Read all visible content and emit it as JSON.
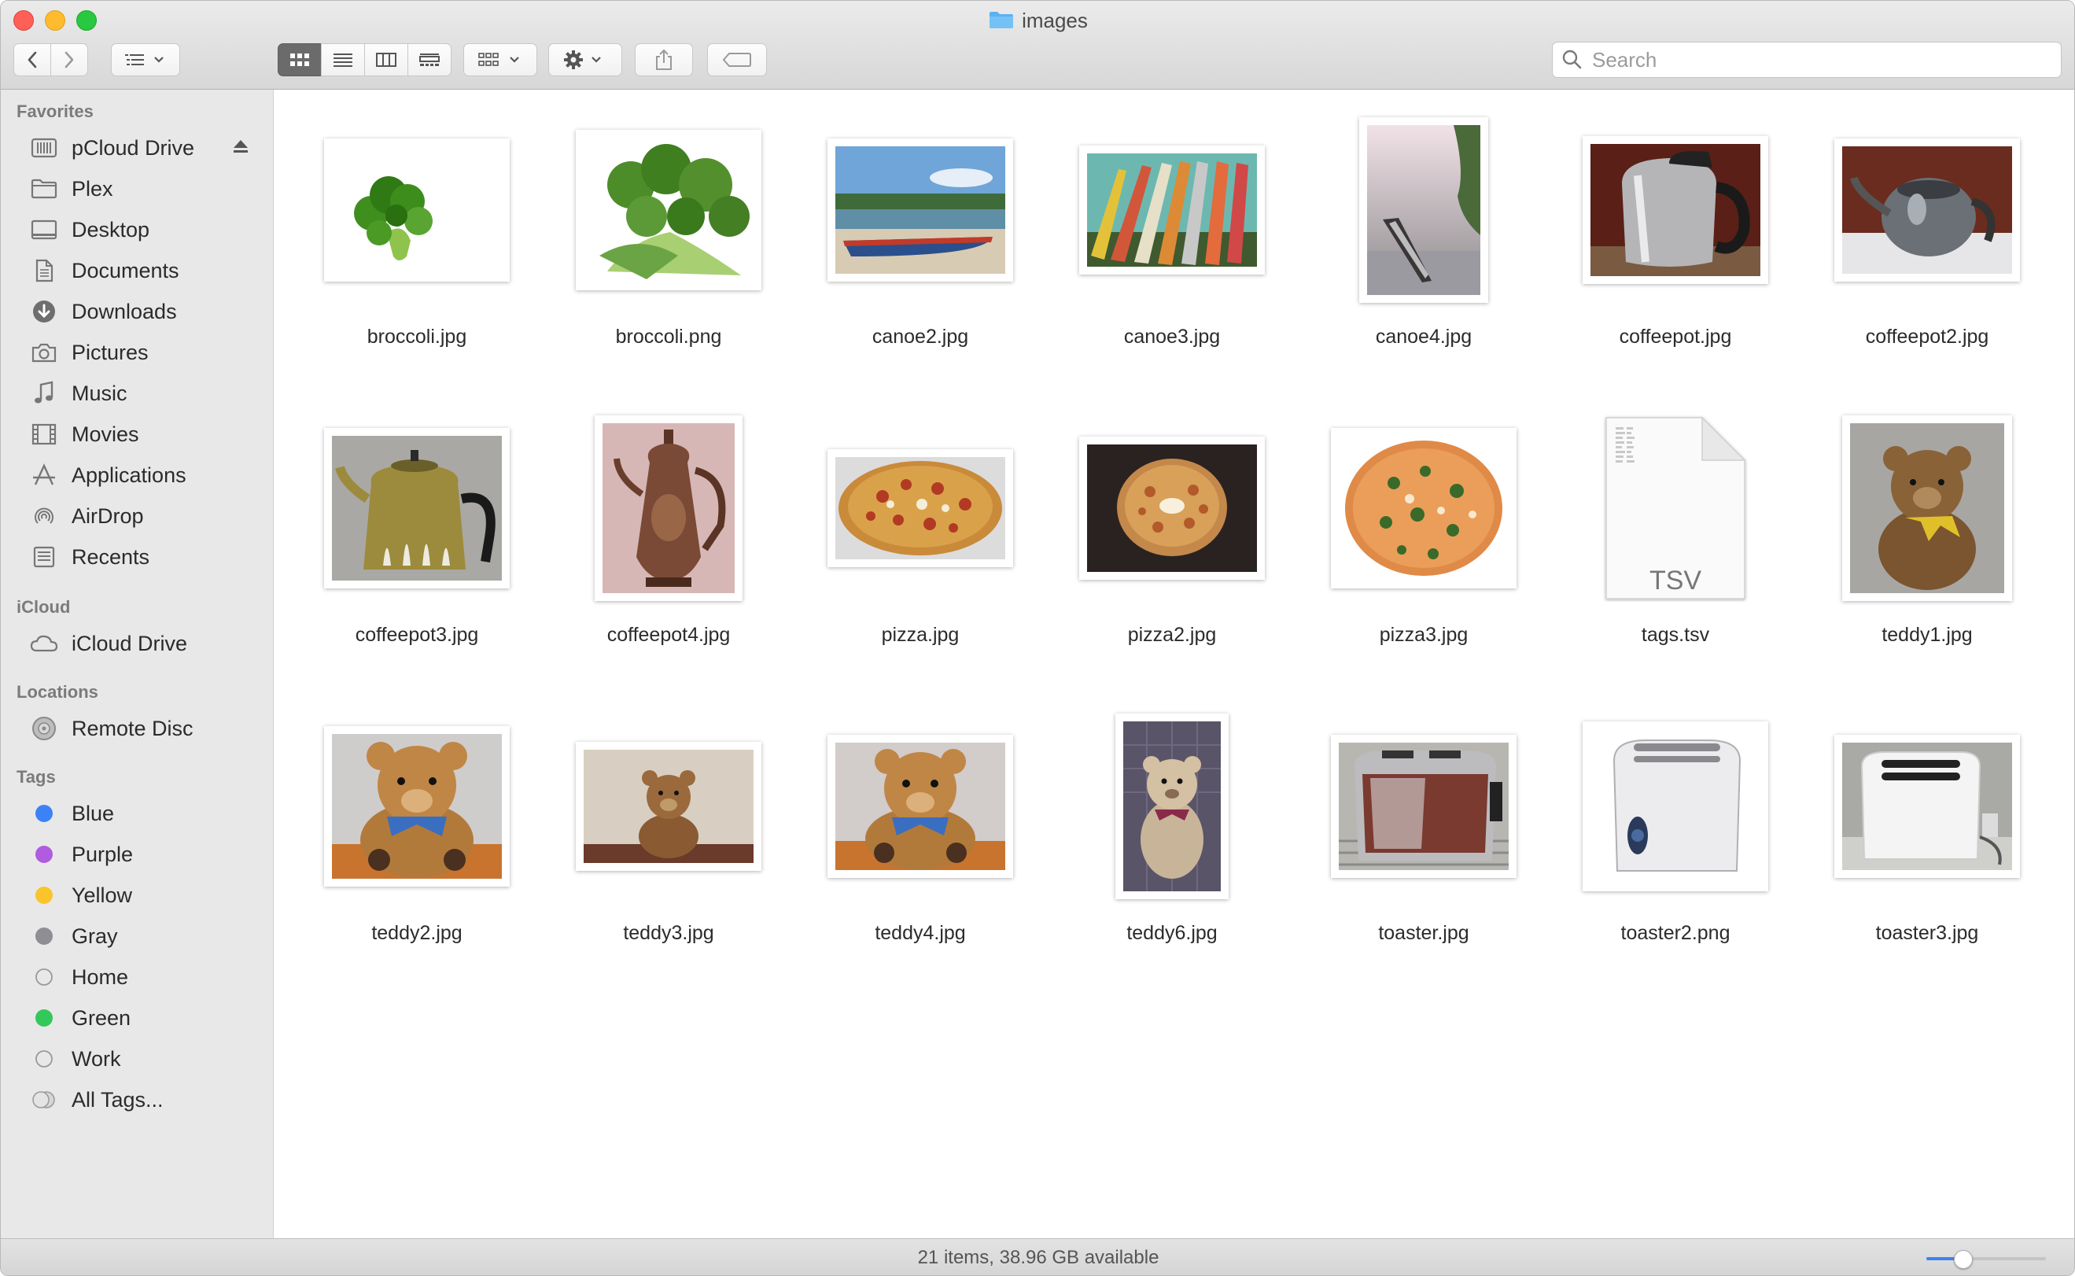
{
  "window": {
    "title": "images"
  },
  "toolbar": {
    "back_icon": "chevron-left-icon",
    "forward_icon": "chevron-right-icon",
    "arrange_icon": "list-arrange-icon",
    "view_modes": [
      "icon-view",
      "list-view",
      "column-view",
      "gallery-view"
    ],
    "active_view": "icon-view",
    "group_icon": "group-grid-icon",
    "action_icon": "gear-icon",
    "share_icon": "share-icon",
    "tag_icon": "tag-icon",
    "search_placeholder": "Search",
    "search_value": ""
  },
  "sidebar": {
    "sections": [
      {
        "header": "Favorites"
      },
      {
        "header": "iCloud"
      },
      {
        "header": "Locations"
      },
      {
        "header": "Tags"
      }
    ],
    "favorites": [
      {
        "label": "pCloud Drive",
        "icon": "drive-icon"
      },
      {
        "label": "Plex",
        "icon": "folder-icon"
      },
      {
        "label": "Desktop",
        "icon": "desktop-icon"
      },
      {
        "label": "Documents",
        "icon": "documents-icon"
      },
      {
        "label": "Downloads",
        "icon": "downloads-icon"
      },
      {
        "label": "Pictures",
        "icon": "camera-icon"
      },
      {
        "label": "Music",
        "icon": "music-note-icon"
      },
      {
        "label": "Movies",
        "icon": "film-icon"
      },
      {
        "label": "Applications",
        "icon": "applications-icon"
      },
      {
        "label": "AirDrop",
        "icon": "airdrop-icon"
      },
      {
        "label": "Recents",
        "icon": "recents-icon"
      }
    ],
    "icloud": [
      {
        "label": "iCloud Drive",
        "icon": "cloud-icon"
      }
    ],
    "locations": [
      {
        "label": "Remote Disc",
        "icon": "disc-icon"
      }
    ],
    "tags": [
      {
        "label": "Blue",
        "color": "#3b82f6"
      },
      {
        "label": "Purple",
        "color": "#b05ce0"
      },
      {
        "label": "Yellow",
        "color": "#fac42d"
      },
      {
        "label": "Gray",
        "color": "#8e8e93"
      },
      {
        "label": "Home",
        "color": "none"
      },
      {
        "label": "Green",
        "color": "#34c759"
      },
      {
        "label": "Work",
        "color": "none"
      },
      {
        "label": "All Tags...",
        "color": "all"
      }
    ]
  },
  "files": [
    {
      "name": "broccoli.jpg"
    },
    {
      "name": "broccoli.png"
    },
    {
      "name": "canoe2.jpg"
    },
    {
      "name": "canoe3.jpg"
    },
    {
      "name": "canoe4.jpg"
    },
    {
      "name": "coffeepot.jpg"
    },
    {
      "name": "coffeepot2.jpg"
    },
    {
      "name": "coffeepot3.jpg"
    },
    {
      "name": "coffeepot4.jpg"
    },
    {
      "name": "pizza.jpg"
    },
    {
      "name": "pizza2.jpg"
    },
    {
      "name": "pizza3.jpg"
    },
    {
      "name": "tags.tsv",
      "doc_label": "TSV"
    },
    {
      "name": "teddy1.jpg"
    },
    {
      "name": "teddy2.jpg"
    },
    {
      "name": "teddy3.jpg"
    },
    {
      "name": "teddy4.jpg"
    },
    {
      "name": "teddy6.jpg"
    },
    {
      "name": "toaster.jpg"
    },
    {
      "name": "toaster2.png"
    },
    {
      "name": "toaster3.jpg"
    }
  ],
  "statusbar": {
    "text": "21 items, 38.96 GB available",
    "icon_size_level": 0.3
  }
}
